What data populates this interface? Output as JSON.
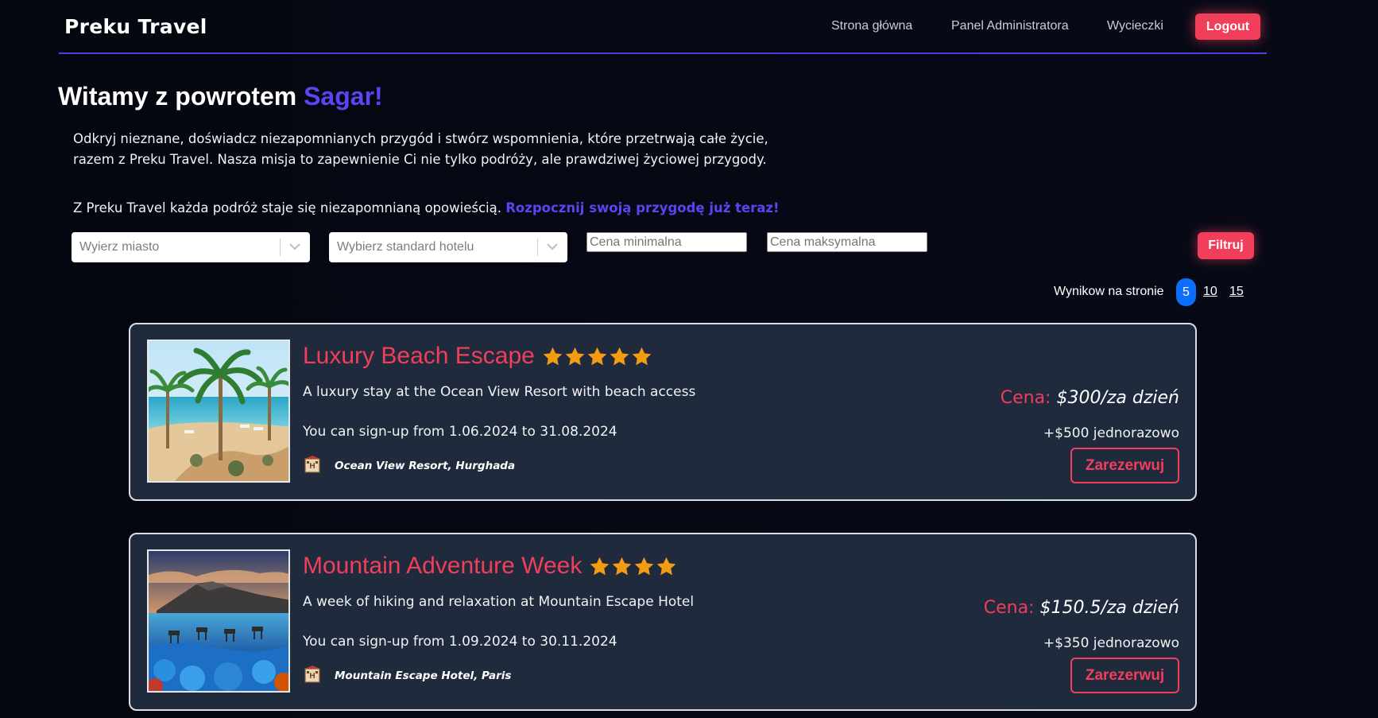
{
  "nav": {
    "brand": "Preku Travel",
    "links": [
      "Strona główna",
      "Panel Administratora",
      "Wycieczki"
    ],
    "logout_label": "Logout"
  },
  "hero": {
    "greeting": "Witamy z powrotem",
    "user_name": "Sagar!",
    "intro": "Odkryj nieznane, doświadcz niezapomnianych przygód i stwórz wspomnienia, które przetrwają całe życie, razem z Preku Travel. Nasza misja to zapewnienie Ci nie tylko podróży, ale prawdziwej życiowej przygody.",
    "tagline": "Z Preku Travel każda podróż staje się niezapomnianą opowieścią.",
    "cta": "Rozpocznij swoją przygodę już teraz!"
  },
  "filters": {
    "city_placeholder": "Wyierz miasto",
    "hotel_placeholder": "Wybierz standard hotelu",
    "min_price_placeholder": "Cena minimalna",
    "max_price_placeholder": "Cena maksymalna",
    "filter_button": "Filtruj"
  },
  "pagination": {
    "label": "Wynikow na stronie",
    "options": [
      "5",
      "10",
      "15"
    ],
    "selected": "5"
  },
  "trips": [
    {
      "title": "Luxury Beach Escape",
      "rating": 5,
      "description": "A luxury stay at the Ocean View Resort with beach access",
      "dates": "You can sign-up from 1.06.2024 to 31.08.2024",
      "hotel": "Ocean View Resort, Hurghada",
      "price_label": "Cena:",
      "price_value": "$300/za dzień",
      "one_time": "+$500 jednorazowo",
      "book_label": "Zarezerwuj",
      "image": "beach-resort-with-palm-trees"
    },
    {
      "title": "Mountain Adventure Week",
      "rating": 4,
      "description": "A week of hiking and relaxation at Mountain Escape Hotel",
      "dates": "You can sign-up from 1.09.2024 to 30.11.2024",
      "hotel": "Mountain Escape Hotel, Paris",
      "price_label": "Cena:",
      "price_value": "$150.5/za dzień",
      "one_time": "+$350 jednorazowo",
      "book_label": "Zarezerwuj",
      "image": "mountain-lake-with-animals"
    }
  ],
  "colors": {
    "accent": "#f03e5b",
    "brand_purple": "#5a45f2",
    "card_bg": "#202a3d",
    "star": "#f39c12",
    "active_page": "#0d6efd"
  }
}
